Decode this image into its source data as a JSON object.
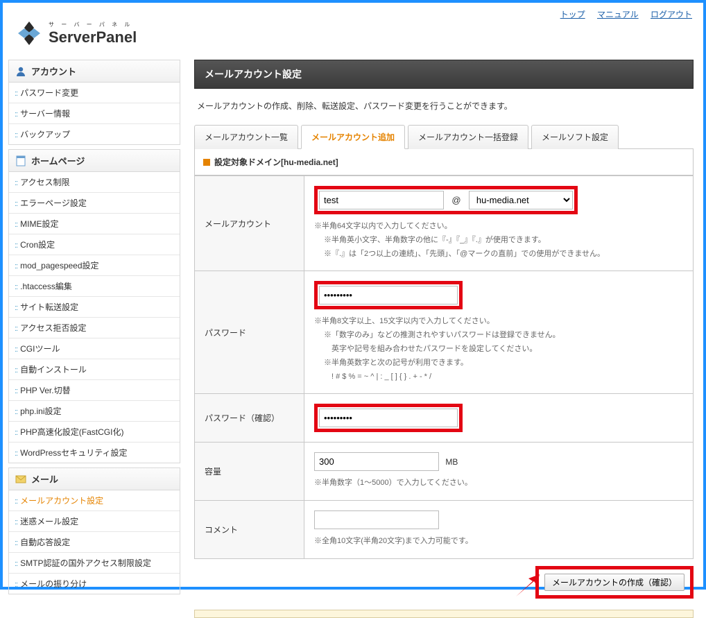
{
  "topLinks": {
    "top": "トップ",
    "manual": "マニュアル",
    "logout": "ログアウト"
  },
  "logo": {
    "kana": "サ ー バ ー パ ネ ル",
    "main": "ServerPanel"
  },
  "sidebar": {
    "sections": [
      {
        "title": "アカウント",
        "icon": "user",
        "items": [
          "パスワード変更",
          "サーバー情報",
          "バックアップ"
        ]
      },
      {
        "title": "ホームページ",
        "icon": "page",
        "items": [
          "アクセス制限",
          "エラーページ設定",
          "MIME設定",
          "Cron設定",
          "mod_pagespeed設定",
          ".htaccess編集",
          "サイト転送設定",
          "アクセス拒否設定",
          "CGIツール",
          "自動インストール",
          "PHP Ver.切替",
          "php.ini設定",
          "PHP高速化設定(FastCGI化)",
          "WordPressセキュリティ設定"
        ]
      },
      {
        "title": "メール",
        "icon": "mail",
        "items": [
          "メールアカウント設定",
          "迷惑メール設定",
          "自動応答設定",
          "SMTP認証の国外アクセス制限設定",
          "メールの振り分け"
        ],
        "activeIndex": 0
      }
    ]
  },
  "page": {
    "title": "メールアカウント設定",
    "desc": "メールアカウントの作成、削除、転送設定、パスワード変更を行うことができます。"
  },
  "tabs": [
    "メールアカウント一覧",
    "メールアカウント追加",
    "メールアカウント一括登録",
    "メールソフト設定"
  ],
  "domainLabel": "設定対象ドメイン",
  "domainValue": "hu-media.net",
  "form": {
    "mailAccount": {
      "label": "メールアカウント",
      "value": "test",
      "at": "@",
      "domainSelected": "hu-media.net",
      "notes": [
        "※半角64文字以内で入力してください。",
        "※半角英小文字、半角数字の他に『-』『_』『.』が使用できます。",
        "※『.』は「2つ以上の連続」、「先頭」、「@マークの直前」での使用ができません。"
      ]
    },
    "password": {
      "label": "パスワード",
      "value": "•••••••••",
      "notes": [
        "※半角8文字以上、15文字以内で入力してください。",
        "※「数字のみ」などの推測されやすいパスワードは登録できません。",
        "　英字や記号を組み合わせたパスワードを設定してください。",
        "※半角英数字と次の記号が利用できます。",
        "　!  #  $  %  =  ~  ^  |  :  _  [  ]  {  }  .  +  -  *  /"
      ]
    },
    "passwordConfirm": {
      "label": "パスワード（確認）",
      "value": "•••••••••"
    },
    "capacity": {
      "label": "容量",
      "value": "300",
      "unit": "MB",
      "note": "※半角数字（1～5000）で入力してください。"
    },
    "comment": {
      "label": "コメント",
      "value": "",
      "note": "※全角10文字(半角20文字)まで入力可能です。"
    },
    "submit": "メールアカウントの作成（確認）"
  }
}
